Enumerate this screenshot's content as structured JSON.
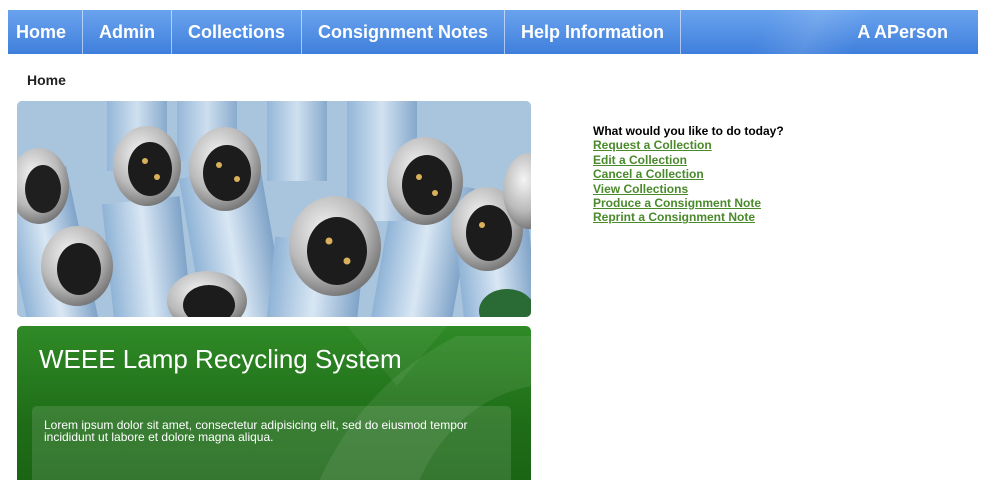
{
  "nav": {
    "items": [
      {
        "label": "Home"
      },
      {
        "label": "Admin"
      },
      {
        "label": "Collections"
      },
      {
        "label": "Consignment Notes"
      },
      {
        "label": "Help Information"
      }
    ],
    "user": "A APerson",
    "color": "#4a86e0"
  },
  "breadcrumb": "Home",
  "promo": {
    "title": "WEEE Lamp Recycling System",
    "body": "Lorem ipsum dolor sit amet, consectetur adipisicing elit, sed do eiusmod tempor incididunt ut labore et dolore magna aliqua.",
    "color": "#1f6d18"
  },
  "actions": {
    "heading": "What would you like to do today?",
    "links": [
      {
        "label": "Request a Collection"
      },
      {
        "label": "Edit a Collection"
      },
      {
        "label": "Cancel a Collection"
      },
      {
        "label": "View Collections"
      },
      {
        "label": "Produce a Consignment Note"
      },
      {
        "label": "Reprint a Consignment Note"
      }
    ],
    "link_color": "#4a8a2b"
  }
}
